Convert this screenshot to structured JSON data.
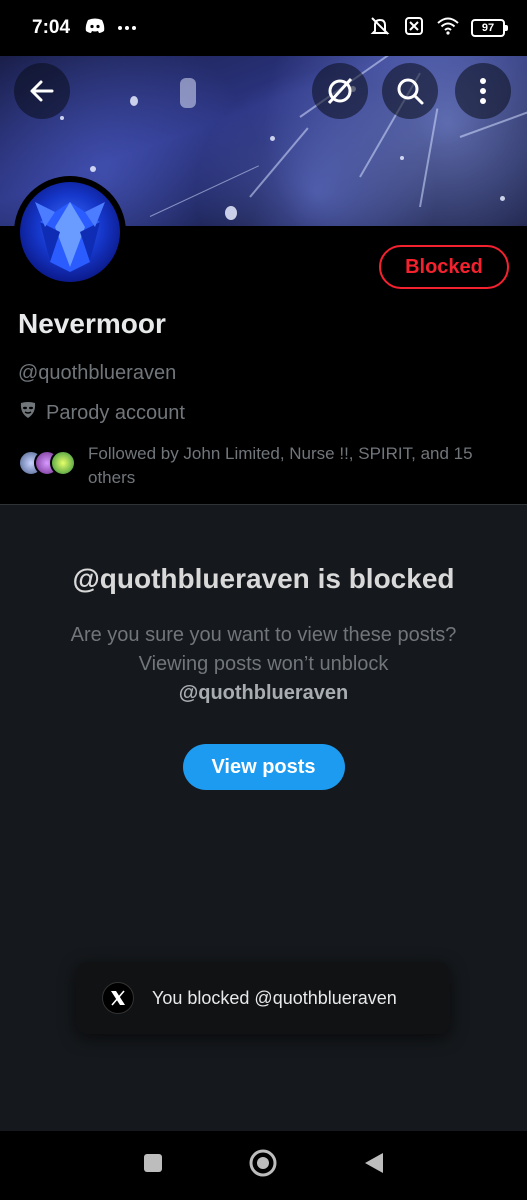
{
  "status_bar": {
    "time": "7:04",
    "battery": "97",
    "icons": [
      "discord-icon",
      "more-dots-icon",
      "bell-muted-icon",
      "no-sim-icon",
      "wifi-icon",
      "battery-icon"
    ]
  },
  "top_actions": {
    "back": "back-arrow-icon",
    "grok": "grok-icon",
    "search": "search-icon",
    "more": "more-vertical-icon"
  },
  "profile": {
    "display_name": "Nevermoor",
    "handle": "@quothblueraven",
    "parody_label": "Parody account",
    "followed_by": "Followed by John Limited, Nurse !!, SPIRIT, and 15 others",
    "blocked_button": "Blocked"
  },
  "blocked_notice": {
    "title": "@quothblueraven is blocked",
    "description": "Are you sure you want to view these posts? Viewing posts won’t unblock",
    "handle": "@quothblueraven",
    "view_posts_button": "View posts"
  },
  "toast": {
    "message": "You blocked @quothblueraven"
  },
  "colors": {
    "accent": "#1d9bf0",
    "blocked_red": "#f4212e",
    "background": "#15181c",
    "secondary_text": "#71767b"
  }
}
